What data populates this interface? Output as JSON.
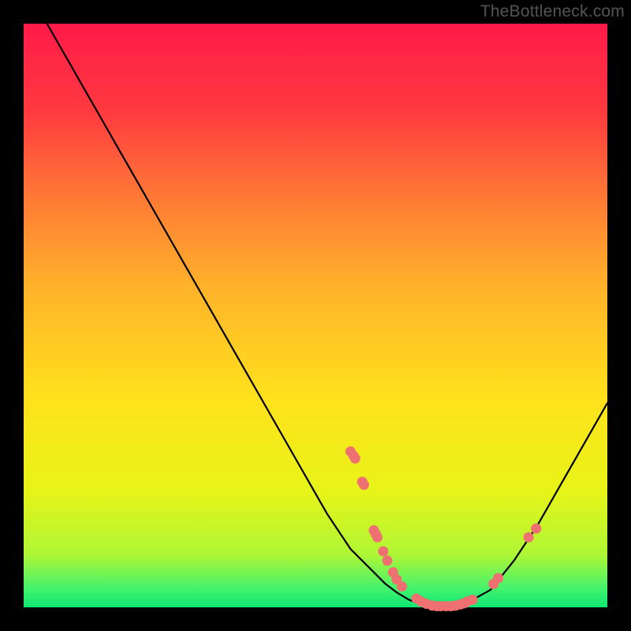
{
  "watermark": "TheBottleneck.com",
  "chart_data": {
    "type": "line",
    "title": "",
    "xlabel": "",
    "ylabel": "",
    "xlim": [
      0,
      100
    ],
    "ylim": [
      0,
      100
    ],
    "bg_gradient_top_hex": "#ff1a49",
    "bg_gradient_bottom_hex": "#0ee874",
    "curve": {
      "x": [
        4,
        8,
        12,
        16,
        20,
        24,
        28,
        32,
        36,
        40,
        44,
        48,
        52,
        56,
        59,
        62,
        64,
        66,
        68,
        70,
        72,
        74,
        76,
        80,
        84,
        88,
        92,
        96,
        100
      ],
      "y": [
        100,
        93,
        86,
        79,
        72,
        65,
        58,
        51,
        44,
        37,
        30,
        23,
        16,
        10,
        7,
        4,
        2.5,
        1.3,
        0.6,
        0.2,
        0.1,
        0.2,
        0.8,
        3,
        8,
        14,
        21,
        28,
        35
      ]
    },
    "markers": {
      "x": [
        56.0,
        56.5,
        56.8,
        58.0,
        58.3,
        60.0,
        60.3,
        60.6,
        61.6,
        62.3,
        63.3,
        63.9,
        64.8,
        67.3,
        68.1,
        69.0,
        70.0,
        70.8,
        71.5,
        72.4,
        73.2,
        74.0,
        74.8,
        75.5,
        76.0,
        76.9,
        80.5,
        81.3,
        86.5,
        87.8
      ],
      "y": [
        26.7,
        26.0,
        25.5,
        21.5,
        21.0,
        13.2,
        12.6,
        12.0,
        9.6,
        8.0,
        6.0,
        4.8,
        3.6,
        1.5,
        1.0,
        0.6,
        0.3,
        0.2,
        0.2,
        0.2,
        0.2,
        0.3,
        0.5,
        0.7,
        1.0,
        1.3,
        4.0,
        5.0,
        12.0,
        13.5
      ],
      "color_hex": "#ef7070",
      "radius_px": 6.5
    }
  }
}
